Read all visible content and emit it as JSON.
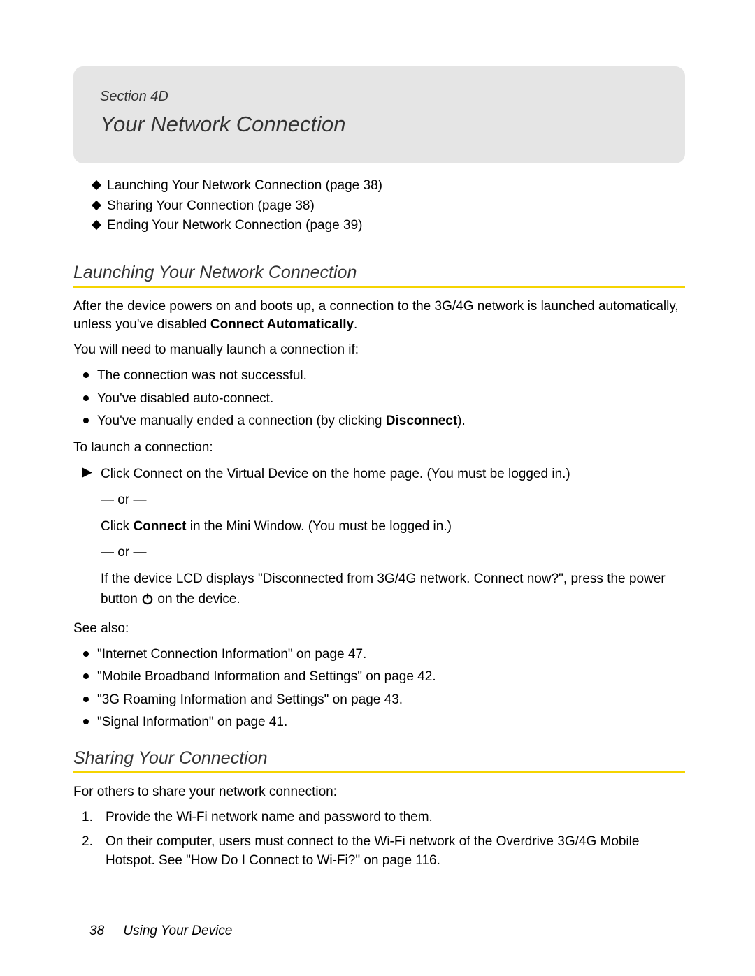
{
  "header": {
    "section_label": "Section 4D",
    "title": "Your Network Connection"
  },
  "toc": [
    "Launching Your Network Connection (page 38)",
    "Sharing Your Connection (page 38)",
    "Ending Your Network Connection (page 39)"
  ],
  "s1": {
    "heading": "Launching Your Network Connection",
    "intro_a": "After the device powers on and boots up, a connection to the 3G/4G network is launched automatically, unless you've disabled ",
    "intro_bold": "Connect Automatically",
    "intro_b": ".",
    "need_manual": "You will need to manually launch a connection if:",
    "manual_bullets": {
      "b1": "The connection was not successful.",
      "b2": "You've disabled auto-connect.",
      "b3a": "You've manually ended a connection (by clicking ",
      "b3bold": "Disconnect",
      "b3b": ")."
    },
    "to_launch": "To launch a connection:",
    "step": {
      "line1": "Click Connect on the Virtual Device on the home page. (You must be logged in.)",
      "or": "— or —",
      "line2a": "Click ",
      "line2bold": "Connect",
      "line2b": " in the Mini Window. (You must be logged in.)",
      "line3a": "If the device LCD displays \"Disconnected from 3G/4G network. Connect now?\", press the power button ",
      "line3b": " on the device."
    },
    "see_also": "See also:",
    "see_bullets": [
      "\"Internet Connection Information\" on page 47.",
      "\"Mobile Broadband Information and Settings\" on page 42.",
      "\"3G Roaming Information and Settings\" on page 43.",
      "\"Signal Information\" on page 41."
    ]
  },
  "s2": {
    "heading": "Sharing Your Connection",
    "intro": "For others to share your network connection:",
    "steps": [
      "Provide the Wi-Fi network name and password to them.",
      "On their computer, users must connect to the Wi-Fi network of the Overdrive 3G/4G Mobile Hotspot. See \"How Do I Connect to Wi-Fi?\" on page 116."
    ]
  },
  "footer": {
    "page": "38",
    "chapter": "Using Your Device"
  }
}
